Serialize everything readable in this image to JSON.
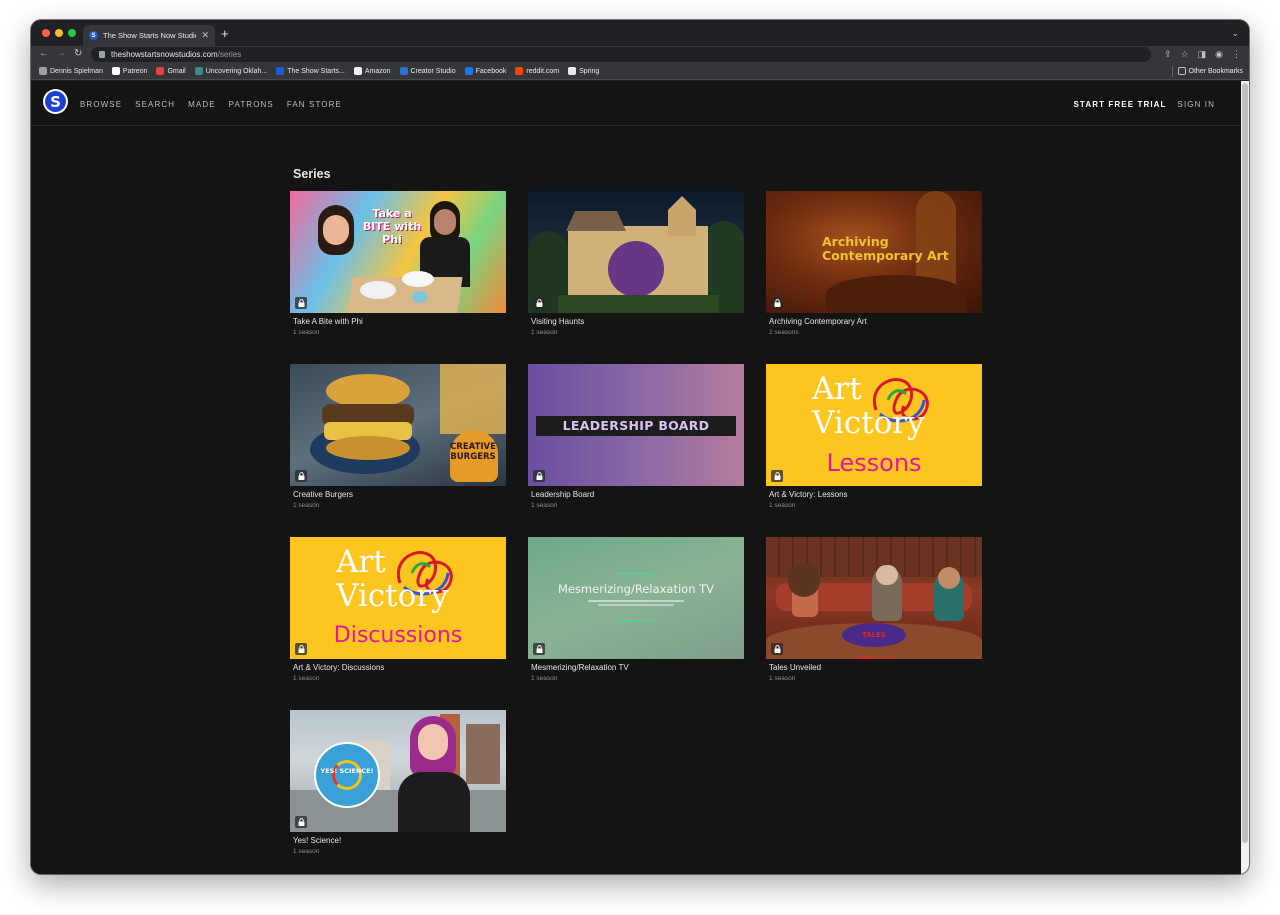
{
  "browser": {
    "tab_title": "The Show Starts Now Studios",
    "tab_favicon": "S",
    "url_host": "theshowstartsnowstudios.com",
    "url_path": "/series",
    "bookmarks": [
      {
        "label": "Dennis Spielman",
        "color": "#9aa0a6"
      },
      {
        "label": "Patreon",
        "color": "#ffffff"
      },
      {
        "label": "Gmail",
        "color": "#ea4335"
      },
      {
        "label": "Uncovering Oklah...",
        "color": "#3c8c8c"
      },
      {
        "label": "The Show Starts...",
        "color": "#1f5dd8"
      },
      {
        "label": "Amazon",
        "color": "#f0f0f0"
      },
      {
        "label": "Creator Studio",
        "color": "#2d6fd6"
      },
      {
        "label": "Facebook",
        "color": "#1877f2"
      },
      {
        "label": "reddit.com",
        "color": "#ff4500"
      },
      {
        "label": "Spring",
        "color": "#e8eaed"
      }
    ],
    "other_bookmarks": "Other Bookmarks"
  },
  "site": {
    "logo_letter": "S",
    "nav": [
      "BROWSE",
      "SEARCH",
      "MADE",
      "PATRONS",
      "FAN STORE"
    ],
    "start_trial": "START FREE TRIAL",
    "sign_in": "SIGN IN",
    "section_title": "Series"
  },
  "series": [
    {
      "title": "Take A Bite with Phi",
      "meta": "1 season",
      "thumb_text": "Take a BITE with Phi"
    },
    {
      "title": "Visiting Haunts",
      "meta": "1 season",
      "thumb_text": ""
    },
    {
      "title": "Archiving Contemporary Art",
      "meta": "2 seasons",
      "thumb_text": "Archiving Contemporary Art"
    },
    {
      "title": "Creative Burgers",
      "meta": "1 season",
      "thumb_text": "CREATIVE BURGERS"
    },
    {
      "title": "Leadership Board",
      "meta": "1 season",
      "thumb_text": "LEADERSHIP BOARD"
    },
    {
      "title": "Art & Victory: Lessons",
      "meta": "1 season",
      "thumb_text": "Art Victory",
      "thumb_sub": "Lessons"
    },
    {
      "title": "Art & Victory: Discussions",
      "meta": "1 season",
      "thumb_text": "Art Victory",
      "thumb_sub": "Discussions"
    },
    {
      "title": "Mesmerizing/Relaxation TV",
      "meta": "1 season",
      "thumb_text": "Mesmerizing/Relaxation TV"
    },
    {
      "title": "Tales Unveiled",
      "meta": "1 season",
      "thumb_text": "TALES UNVEILED"
    },
    {
      "title": "Yes! Science!",
      "meta": "1 season",
      "thumb_text": "YES! SCIENCE!"
    }
  ]
}
